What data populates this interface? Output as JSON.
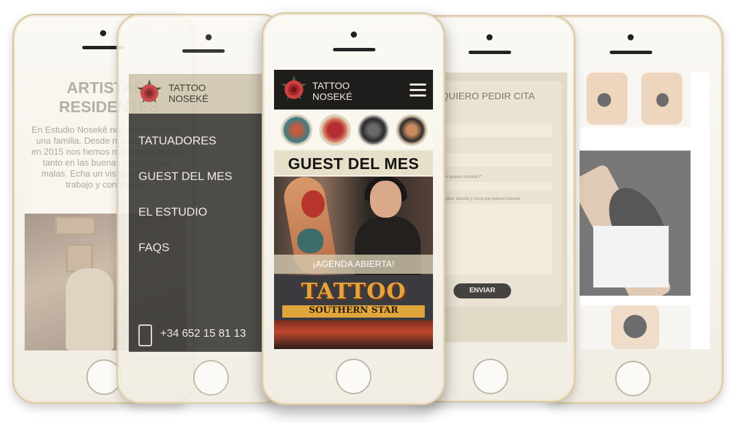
{
  "artists_screen": {
    "title": "ARTISTAS RESIDENTES",
    "text": "En Estudio Nosekê nos consideramos una familia. Desde nuestra apertura en 2015 nos hemos mantenido unidos tanto en las buenas como en las malas. Echa un vistazo a nuestro trabajo y conócenos."
  },
  "menu_screen": {
    "brand_line1": "TATTOO",
    "brand_line2": "NOSEKÉ",
    "items": [
      {
        "label": "TATUADORES"
      },
      {
        "label": "GUEST DEL MES"
      },
      {
        "label": "EL ESTUDIO"
      },
      {
        "label": "FAQS"
      }
    ],
    "phone_number": "+34 652 15 81 13"
  },
  "home_screen": {
    "brand_line1": "TATTOO",
    "brand_line2": "NOSEKÉ",
    "guest_title": "GUEST DEL MES",
    "guest_cta": "¡AGENDA ABIERTA!",
    "sign_title": "TATTOO",
    "sign_subtitle": "SOUTHERN STAR"
  },
  "form_screen": {
    "title": "QUIERO PEDIR CITA",
    "label_where": "dón quieres tatuarte?*",
    "label_idea": "tu idea, tamaño y zona que quieras hacerte",
    "submit_label": "ENVIAR"
  },
  "colors": {
    "header_dark": "#1e1d1b",
    "beige": "#e7dfc9",
    "menu_bg": "#3b3a36",
    "gold_frame": "#d9c7a4"
  }
}
